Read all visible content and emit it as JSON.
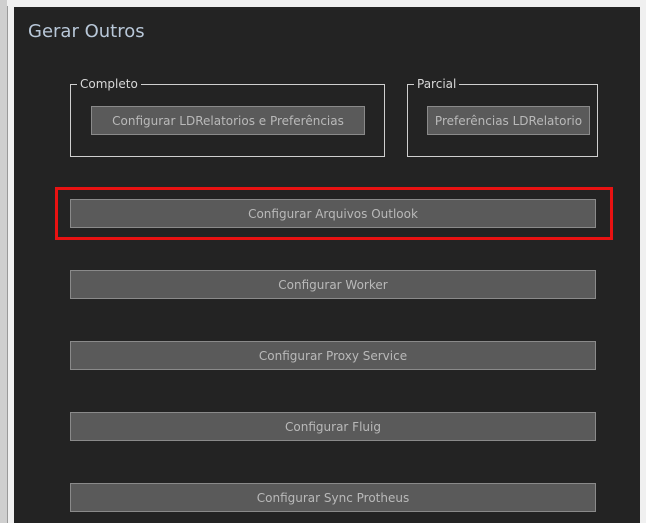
{
  "panel": {
    "title": "Gerar Outros"
  },
  "groups": {
    "completo": {
      "legend": "Completo",
      "button_label": "Configurar LDRelatorios e Preferências"
    },
    "parcial": {
      "legend": "Parcial",
      "button_label": "Preferências LDRelatorio"
    }
  },
  "buttons": {
    "outlook": "Configurar Arquivos Outlook",
    "worker": "Configurar Worker",
    "proxy": "Configurar Proxy Service",
    "fluig": "Configurar Fluig",
    "sync_protheus": "Configurar Sync Protheus"
  },
  "colors": {
    "panel_bg": "#232323",
    "button_bg": "#5a5a5a",
    "title_text": "#b8c7d8",
    "highlight": "#e81212"
  }
}
